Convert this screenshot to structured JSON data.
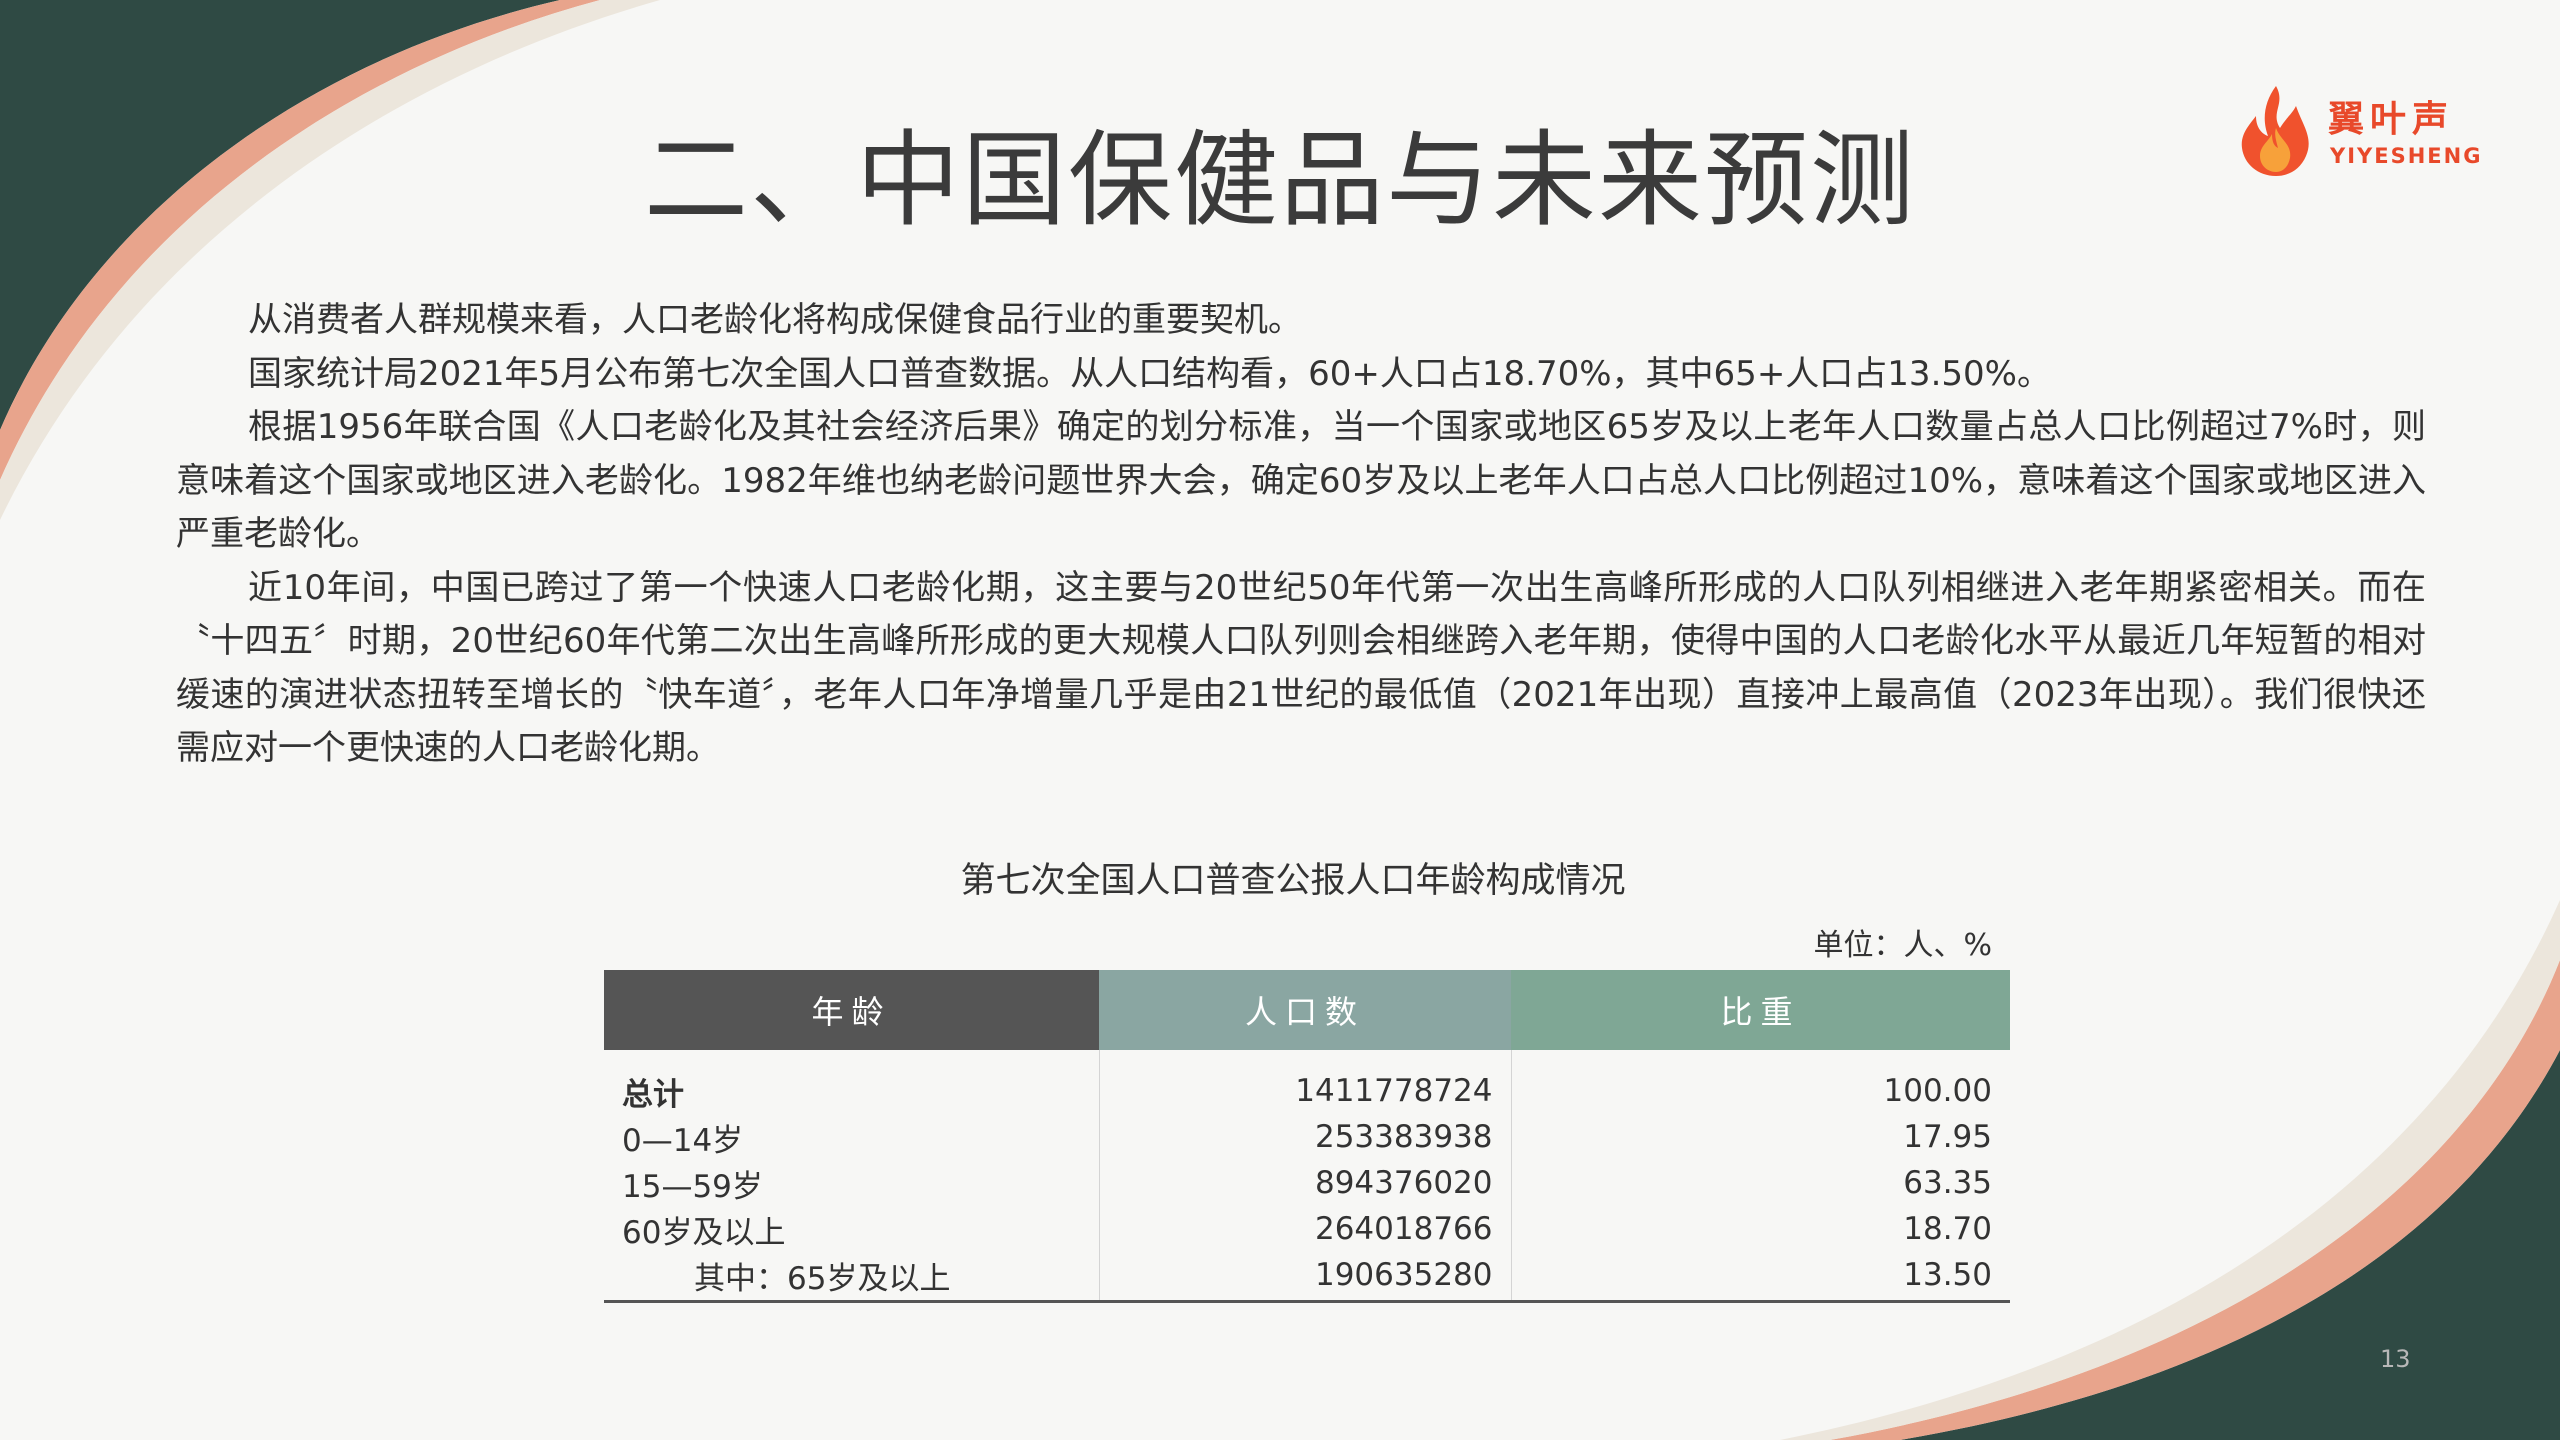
{
  "slide": {
    "title": "二、中国保健品与未来预测",
    "page_number": "13",
    "colors": {
      "dark_green": "#2f4a44",
      "salmon": "#e8a48c",
      "cream": "#e9e3d8",
      "brand_red": "#e8492a"
    }
  },
  "logo": {
    "icon": "flame-logo-icon",
    "cn": "翼叶声",
    "en": "YIYESHENG"
  },
  "paragraphs": [
    "从消费者人群规模来看，人口老龄化将构成保健食品行业的重要契机。",
    "国家统计局2021年5月公布第七次全国人口普查数据。从人口结构看，60+人口占18.70%，其中65+人口占13.50%。",
    "根据1956年联合国《人口老龄化及其社会经济后果》确定的划分标准，当一个国家或地区65岁及以上老年人口数量占总人口比例超过7%时，则意味着这个国家或地区进入老龄化。1982年维也纳老龄问题世界大会，确定60岁及以上老年人口占总人口比例超过10%，意味着这个国家或地区进入严重老龄化。",
    "近10年间，中国已跨过了第一个快速人口老龄化期，这主要与20世纪50年代第一次出生高峰所形成的人口队列相继进入老年期紧密相关。而在〝十四五〞时期，20世纪60年代第二次出生高峰所形成的更大规模人口队列则会相继跨入老年期，使得中国的人口老龄化水平从最近几年短暂的相对缓速的演进状态扭转至增长的〝快车道〞，老年人口年净增量几乎是由21世纪的最低值（2021年出现）直接冲上最高值（2023年出现）。我们很快还需应对一个更快速的人口老龄化期。"
  ],
  "table": {
    "caption": "第七次全国人口普查公报人口年龄构成情况",
    "unit": "单位：人、%",
    "headers": [
      "年龄",
      "人口数",
      "比重"
    ],
    "rows": [
      {
        "label": "总计",
        "count": "1411778724",
        "share": "100.00"
      },
      {
        "label": "0—14岁",
        "count": "253383938",
        "share": "17.95"
      },
      {
        "label": "15—59岁",
        "count": "894376020",
        "share": "63.35"
      },
      {
        "label": "60岁及以上",
        "count": "264018766",
        "share": "18.70"
      },
      {
        "label": "其中：65岁及以上",
        "count": "190635280",
        "share": "13.50"
      }
    ]
  }
}
